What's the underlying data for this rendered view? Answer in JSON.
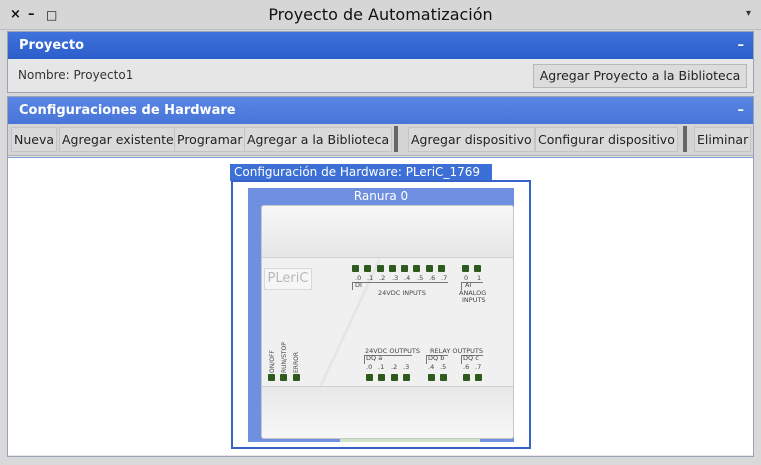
{
  "window": {
    "title": "Proyecto de Automatización",
    "controls": {
      "close": "×",
      "minimize": "–",
      "maximize": "□",
      "menu": "▾"
    }
  },
  "project": {
    "header": "Proyecto",
    "collapse": "–",
    "name_label": "Nombre: Proyecto1",
    "add_to_library": "Agregar Proyecto a la Biblioteca"
  },
  "hardware": {
    "header": "Configuraciones de Hardware",
    "collapse": "–",
    "toolbar": {
      "new": "Nueva",
      "add_existing": "Agregar existente",
      "program": "Programar",
      "add_to_library": "Agregar a la Biblioteca",
      "add_device": "Agregar dispositivo",
      "configure_device": "Configurar dispositivo",
      "delete": "Eliminar"
    },
    "config_label": "Configuración de Hardware: PLeriC_1769",
    "slot": "Ranura 0",
    "plc": {
      "brand": "PLeriC",
      "di_bits": [
        ".0",
        ".1",
        ".2",
        ".3",
        ".4",
        ".5",
        ".6",
        ".7"
      ],
      "di_group": "DI",
      "di_caption": "24VDC INPUTS",
      "ai_bits": [
        "0",
        "1"
      ],
      "ai_group": "AI",
      "ai_caption_1": "ANALOG",
      "ai_caption_2": "INPUTS",
      "status": [
        "ON/OFF",
        "RUN/STOP",
        "ERROR"
      ],
      "dq_caption": "24VDC OUTPUTS",
      "dq_a": "DQ a",
      "dq_a_bits": [
        ".0",
        ".1",
        ".2",
        ".3"
      ],
      "relay_caption": "RELAY OUTPUTS",
      "dq_b": "DQ b",
      "dq_b_bits": [
        ".4",
        ".5"
      ],
      "dq_c": "DQ c",
      "dq_c_bits": [
        ".6",
        ".7"
      ]
    }
  },
  "colors": {
    "header_blue": "#2c5ecb",
    "led_green": "#2e5a1e",
    "frame_blue": "#3563c7"
  }
}
